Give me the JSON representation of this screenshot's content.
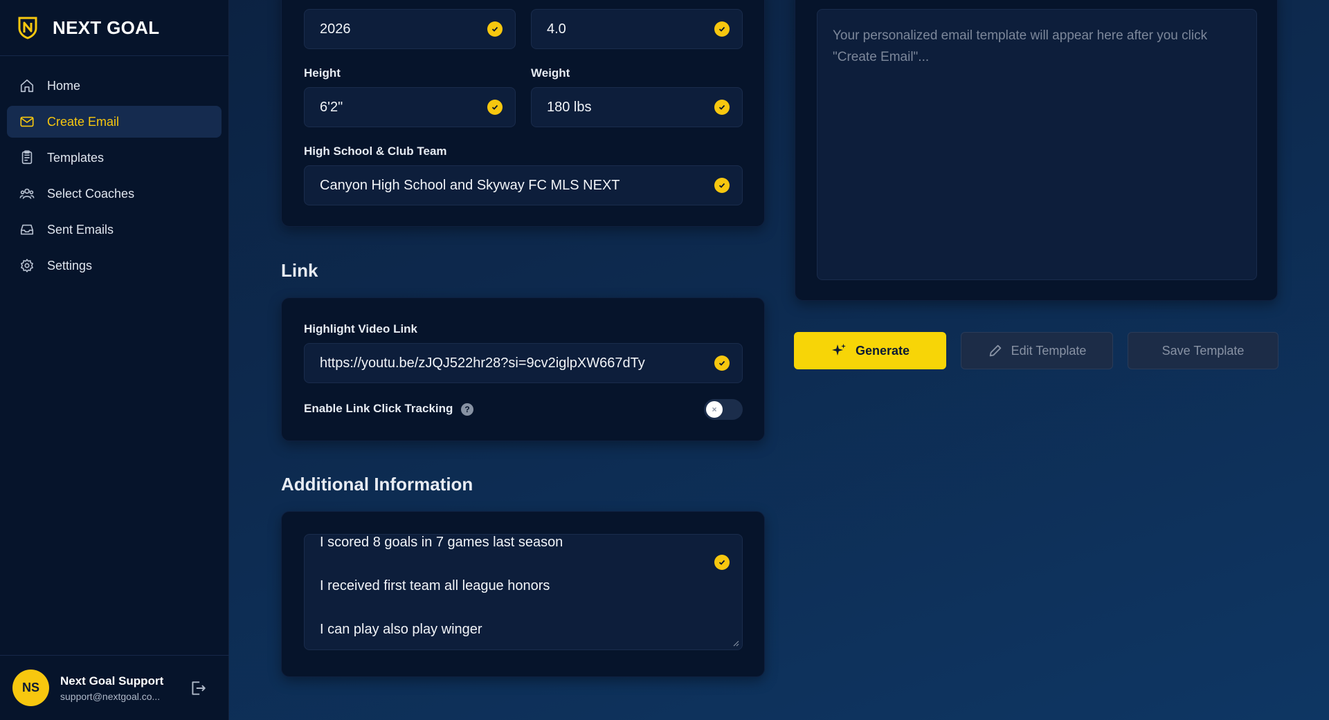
{
  "brand": {
    "name": "NEXT GOAL"
  },
  "nav": {
    "items": [
      {
        "label": "Home",
        "icon": "home-icon"
      },
      {
        "label": "Create Email",
        "icon": "mail-icon",
        "active": true
      },
      {
        "label": "Templates",
        "icon": "templates-icon"
      },
      {
        "label": "Select Coaches",
        "icon": "users-icon"
      },
      {
        "label": "Sent Emails",
        "icon": "inbox-icon"
      },
      {
        "label": "Settings",
        "icon": "gear-icon"
      }
    ]
  },
  "user": {
    "initials": "NS",
    "name": "Next Goal Support",
    "email": "support@nextgoal.co..."
  },
  "profile": {
    "graduation_year": "2026",
    "gpa": "4.0",
    "height_label": "Height",
    "height": "6'2\"",
    "weight_label": "Weight",
    "weight": "180 lbs",
    "team_label": "High School & Club Team",
    "team": "Canyon High School and Skyway FC MLS NEXT"
  },
  "link": {
    "section_title": "Link",
    "video_label": "Highlight Video Link",
    "video_url": "https://youtu.be/zJQJ522hr28?si=9cv2iglpXW667dTy",
    "tracking_label": "Enable Link Click Tracking",
    "tracking_enabled": false,
    "toggle_off_glyph": "×",
    "help_glyph": "?"
  },
  "additional": {
    "section_title": "Additional Information",
    "lines": [
      "I scored 8 goals in 7 games last season",
      "I received first team all league honors",
      "I can play also play winger"
    ]
  },
  "email_template": {
    "placeholder": "Your personalized email template will appear here after you click \"Create Email\"..."
  },
  "actions": {
    "generate": "Generate",
    "edit": "Edit Template",
    "save": "Save Template"
  },
  "colors": {
    "accent": "#f7c70f",
    "sidebar_bg": "#06142b",
    "card_bg": "#06142b",
    "input_bg": "#0d1e3b"
  }
}
